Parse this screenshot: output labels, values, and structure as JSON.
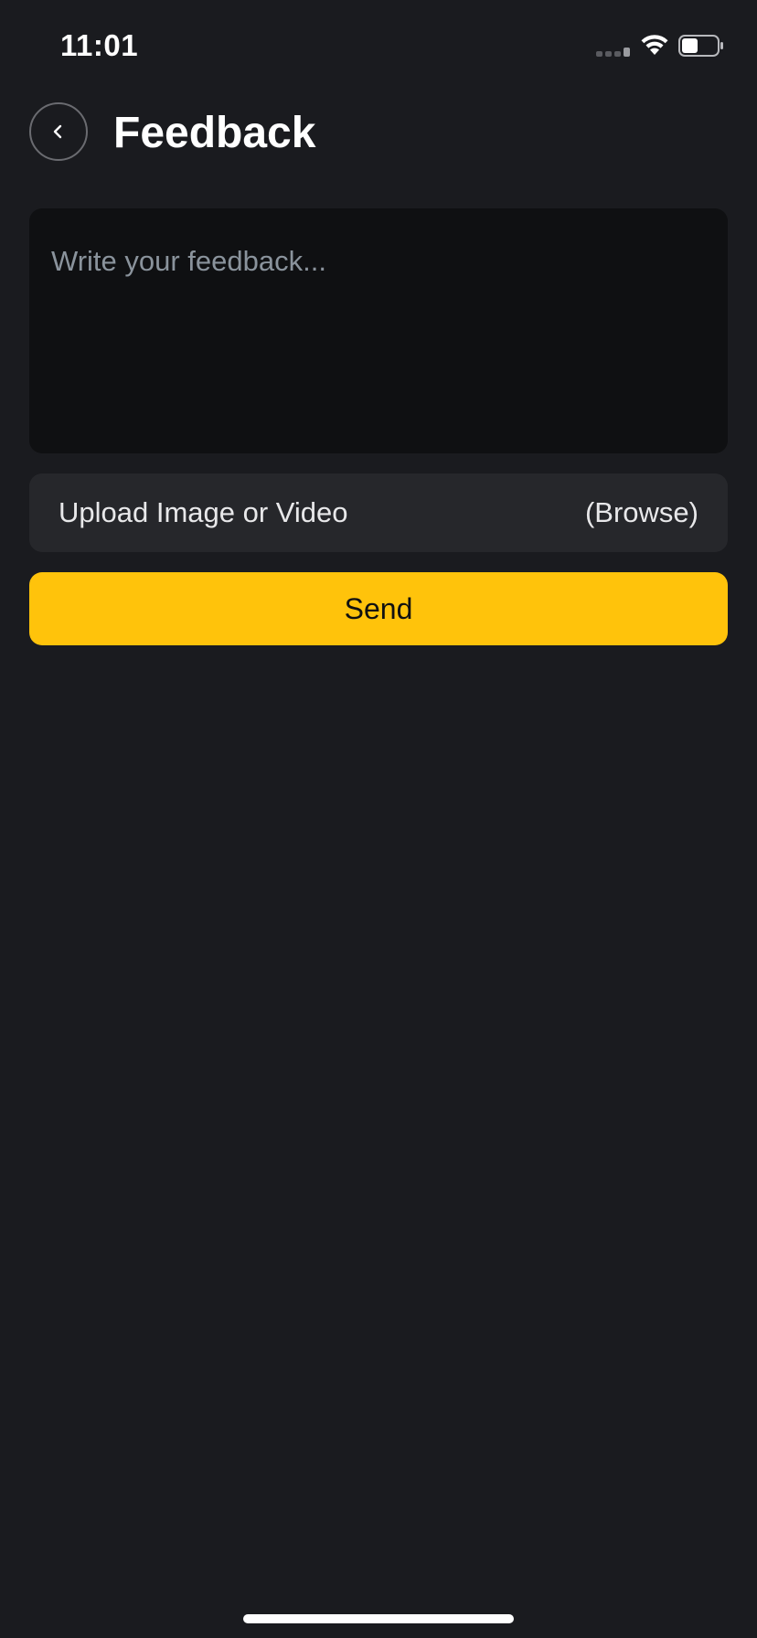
{
  "status_bar": {
    "time": "11:01",
    "battery_level": 0.45
  },
  "header": {
    "title": "Feedback",
    "back_icon": "chevron-left-icon"
  },
  "feedback": {
    "placeholder": "Write your feedback..."
  },
  "upload": {
    "label": "Upload Image or Video",
    "browse_label": "(Browse)"
  },
  "send": {
    "label": "Send"
  },
  "colors": {
    "background": "#1a1b1f",
    "input_background": "#0f1012",
    "upload_background": "#26272b",
    "accent": "#ffc30b"
  }
}
